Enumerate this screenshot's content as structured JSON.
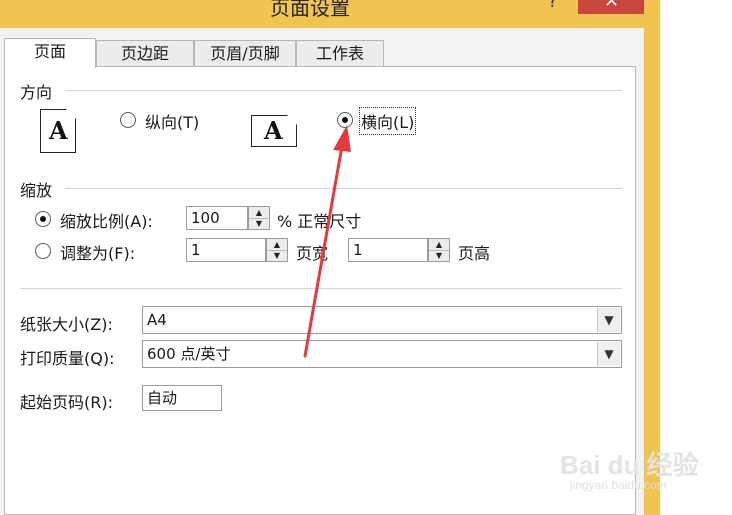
{
  "window": {
    "title": "页面设置",
    "help_label": "?",
    "close_label": "✕"
  },
  "tabs": [
    {
      "label": "页面",
      "active": true
    },
    {
      "label": "页边距",
      "active": false
    },
    {
      "label": "页眉/页脚",
      "active": false
    },
    {
      "label": "工作表",
      "active": false
    }
  ],
  "orientation": {
    "label": "方向",
    "portrait_label": "纵向(T)",
    "landscape_label": "横向(L)",
    "icon_letter": "A",
    "selected": "landscape"
  },
  "scaling": {
    "label": "缩放",
    "adjust_to_label": "缩放比例(A):",
    "adjust_value": "100",
    "percent_suffix": "% 正常尺寸",
    "fit_to_label": "调整为(F):",
    "fit_wide_value": "1",
    "fit_wide_suffix": "页宽",
    "fit_tall_value": "1",
    "fit_tall_suffix": "页高",
    "selected": "adjust_to",
    "spin_up": "▲",
    "spin_down": "▼"
  },
  "paper": {
    "size_label": "纸张大小(Z):",
    "size_value": "A4",
    "quality_label": "打印质量(Q):",
    "quality_value": "600 点/英寸",
    "dropdown_glyph": "▼"
  },
  "first_page": {
    "label": "起始页码(R):",
    "value": "自动"
  },
  "annotation": {
    "arrow_color": "#e8383a"
  },
  "watermark": {
    "text": "Bai du 经验",
    "sub": "jingyan.baidu.com"
  }
}
